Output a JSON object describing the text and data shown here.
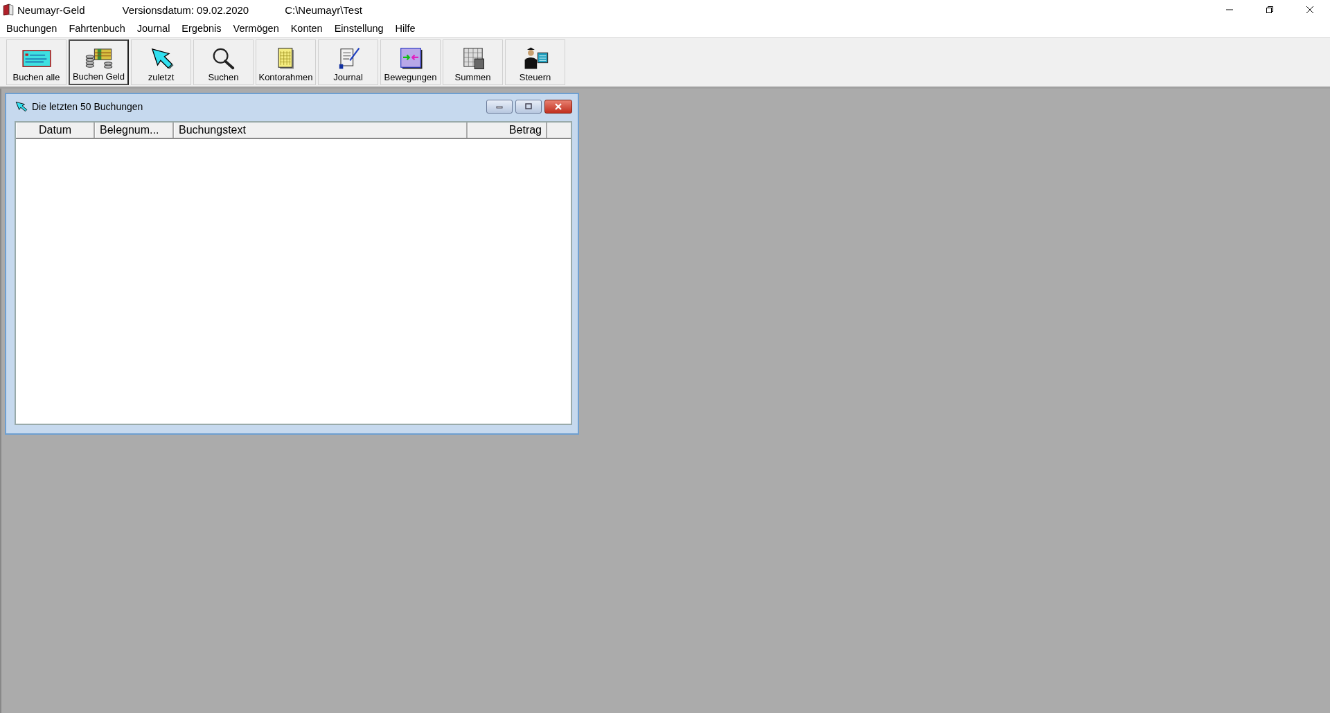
{
  "app": {
    "title": "Neumayr-Geld",
    "version": "Versionsdatum: 09.02.2020",
    "path": "C:\\Neumayr\\Test"
  },
  "menu": [
    {
      "label": "Buchungen"
    },
    {
      "label": "Fahrtenbuch"
    },
    {
      "label": "Journal"
    },
    {
      "label": "Ergebnis"
    },
    {
      "label": "Vermögen"
    },
    {
      "label": "Konten"
    },
    {
      "label": "Einstellung"
    },
    {
      "label": "Hilfe"
    }
  ],
  "toolbar": [
    {
      "label": "Buchen alle",
      "kind": "card",
      "selected": false
    },
    {
      "label": "Buchen Geld",
      "kind": "money",
      "selected": true
    },
    {
      "label": "zuletzt",
      "kind": "arrow",
      "selected": false
    },
    {
      "label": "Suchen",
      "kind": "search",
      "selected": false
    },
    {
      "label": "Kontorahmen",
      "kind": "ledger",
      "selected": false
    },
    {
      "label": "Journal",
      "kind": "scroll",
      "selected": false
    },
    {
      "label": "Bewegungen",
      "kind": "transfer",
      "selected": false
    },
    {
      "label": "Summen",
      "kind": "calculator",
      "selected": false
    },
    {
      "label": "Steuern",
      "kind": "person",
      "selected": false
    }
  ],
  "child_window": {
    "title": "Die letzten 50 Buchungen",
    "columns": [
      {
        "label": "Datum"
      },
      {
        "label": "Belegnum..."
      },
      {
        "label": "Buchungstext"
      },
      {
        "label": "Betrag"
      }
    ]
  }
}
